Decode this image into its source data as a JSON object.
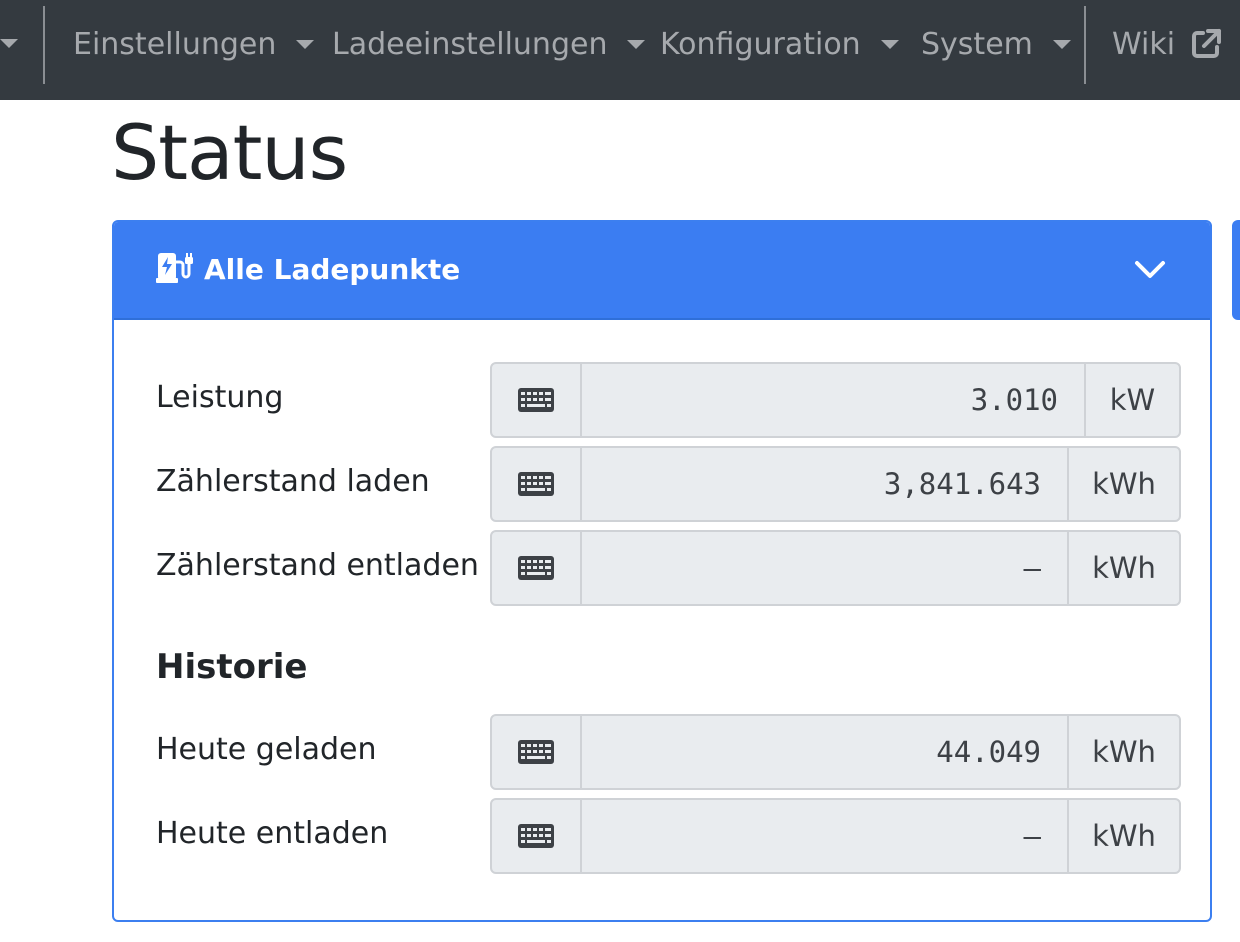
{
  "nav": {
    "items": [
      {
        "label": "Einstellungen"
      },
      {
        "label": "Ladeeinstellungen"
      },
      {
        "label": "Konfiguration"
      },
      {
        "label": "System"
      }
    ],
    "wiki_label": "Wiki"
  },
  "page": {
    "title": "Status"
  },
  "card": {
    "title": "Alle Ladepunkte",
    "rows": [
      {
        "label": "Leistung",
        "value": "3.010",
        "unit": "kW"
      },
      {
        "label": "Zählerstand laden",
        "value": "3,841.643",
        "unit": "kWh"
      },
      {
        "label": "Zählerstand entladen",
        "value": "–",
        "unit": "kWh"
      }
    ],
    "history_heading": "Historie",
    "history_rows": [
      {
        "label": "Heute geladen",
        "value": "44.049",
        "unit": "kWh"
      },
      {
        "label": "Heute entladen",
        "value": "–",
        "unit": "kWh"
      }
    ]
  },
  "colors": {
    "navbar": "#343a40",
    "accent": "#3b7df2",
    "input_bg": "#e9ecef"
  },
  "icons": {
    "header": "charging-station-icon",
    "toggle": "chevron-down-icon",
    "field": "keyboard-icon",
    "wiki": "external-link-icon"
  }
}
